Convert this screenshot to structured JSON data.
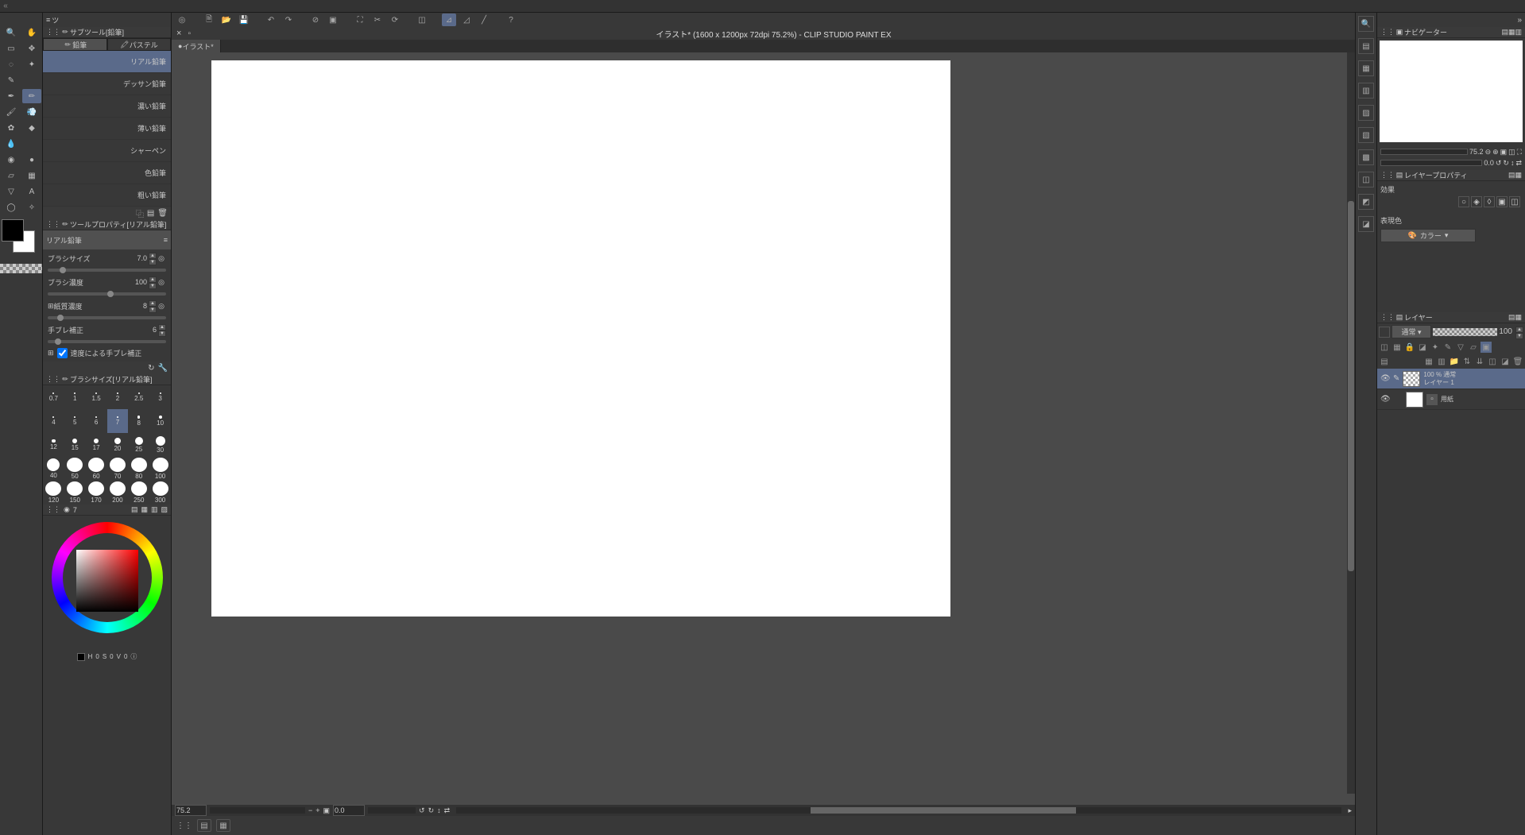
{
  "app": {
    "doc_title": "イラスト* (1600 x 1200px 72dpi 75.2%)  - CLIP STUDIO PAINT EX",
    "doc_tab": "イラスト*"
  },
  "subtool": {
    "header": "サブツール[鉛筆]",
    "tabs": {
      "pencil": "鉛筆",
      "pastel": "パステル"
    },
    "items": [
      "リアル鉛筆",
      "デッサン鉛筆",
      "濃い鉛筆",
      "薄い鉛筆",
      "シャーペン",
      "色鉛筆",
      "粗い鉛筆"
    ]
  },
  "toolprop": {
    "header": "ツールプロパティ[リアル鉛筆]",
    "preview_label": "リアル鉛筆",
    "brush_size_label": "ブラシサイズ",
    "brush_size_val": "7.0",
    "density_label": "ブラシ濃度",
    "density_val": "100",
    "paper_label": "紙質濃度",
    "paper_val": "8",
    "stab_label": "手ブレ補正",
    "stab_val": "6",
    "speed_label": "速度による手ブレ補正"
  },
  "brushsize": {
    "header": "ブラシサイズ[リアル鉛筆]",
    "sizes": [
      "0.7",
      "1",
      "1.5",
      "2",
      "2.5",
      "3",
      "4",
      "5",
      "6",
      "7",
      "8",
      "10",
      "12",
      "15",
      "17",
      "20",
      "25",
      "30",
      "40",
      "50",
      "60",
      "70",
      "80",
      "100",
      "120",
      "150",
      "170",
      "200",
      "250",
      "300"
    ],
    "selected": "7"
  },
  "color": {
    "hsv_label": "H",
    "h": "0",
    "s_label": "S",
    "s": "0",
    "v_label": "V",
    "v": "0",
    "current_size": "7"
  },
  "canvas": {
    "zoom": "75.2",
    "rotation": "0.0"
  },
  "navigator": {
    "header": "ナビゲーター",
    "zoom": "75.2",
    "rotation": "0.0"
  },
  "layerprop": {
    "header": "レイヤープロパティ",
    "effect_label": "効果",
    "expr_label": "表現色",
    "expr_val": "カラー"
  },
  "layer": {
    "header": "レイヤー",
    "blend": "通常",
    "opacity": "100",
    "layers": [
      {
        "opacity_text": "100 % 通常",
        "name": "レイヤー 1"
      },
      {
        "name": "用紙"
      }
    ]
  }
}
